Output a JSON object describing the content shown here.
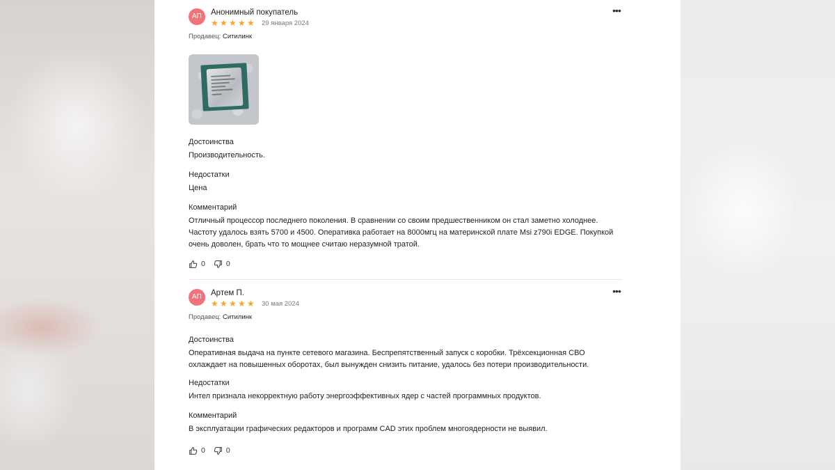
{
  "reviews": [
    {
      "avatar_initials": "АП",
      "author": "Анонимный покупатель",
      "rating": 5,
      "date": "29 января 2024",
      "seller_label": "Продавец:",
      "seller_name": "Ситилинк",
      "has_photo": true,
      "sections": [
        {
          "title": "Достоинства",
          "text": "Производительность."
        },
        {
          "title": "Недостатки",
          "text": "Цена"
        },
        {
          "title": "Комментарий",
          "text": "Отличный процессор последнего поколения. В сравнении со своим предшественником он стал заметно холоднее. Частоту удалось взять 5700 и 4500. Оперативка работает на 8000мгц на материнской плате Msi z790i EDGE. Покупкой очень доволен, брать что то мощнее считаю неразумной тратой."
        }
      ],
      "likes": "0",
      "dislikes": "0"
    },
    {
      "avatar_initials": "АП",
      "author": "Артем П.",
      "rating": 5,
      "date": "30 мая 2024",
      "seller_label": "Продавец:",
      "seller_name": "Ситилинк",
      "has_photo": false,
      "sections": [
        {
          "title": "Достоинства",
          "text": "Оперативная выдача на пункте сетевого магазина. Беспрепятственный запуск с коробки. Трёхсекционная СВО охлаждает на повышенных оборотах, был вынужден снизить питание, удалось без потери производительности."
        },
        {
          "title": "Недостатки",
          "text": "Интел признала некорректную работу энергоэффективных ядер с частей программных продуктов."
        },
        {
          "title": "Комментарий",
          "text": "В эксплуатации графических редакторов и программ CAD этих проблем многоядерности не выявил."
        }
      ],
      "likes": "0",
      "dislikes": "0"
    }
  ],
  "icons": {
    "star": "star-icon",
    "more": "more-dots-icon",
    "like": "thumbs-up-icon",
    "dislike": "thumbs-down-icon"
  },
  "colors": {
    "avatar_bg": "#f0727a",
    "star": "#f5a623"
  }
}
